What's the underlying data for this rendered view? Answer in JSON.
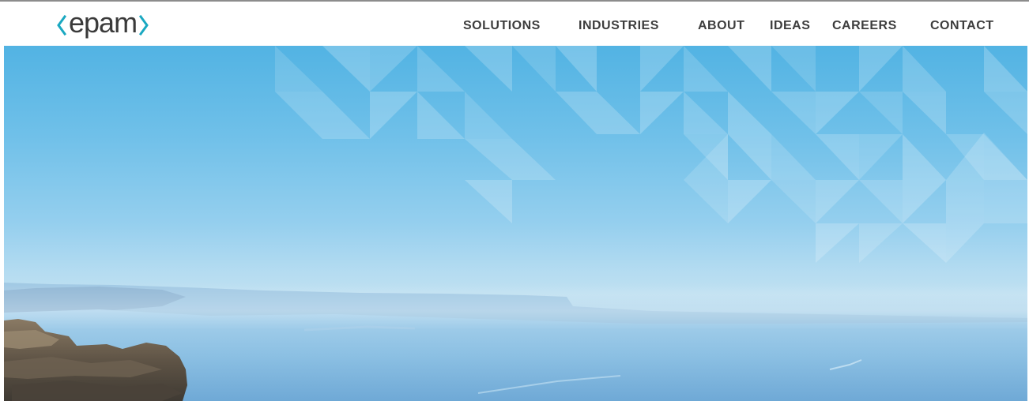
{
  "brand": {
    "logo_text": "epam",
    "accent_color": "#1aa8c1"
  },
  "nav": {
    "items": [
      {
        "id": "solutions",
        "label": "SOLUTIONS"
      },
      {
        "id": "industries",
        "label": "INDUSTRIES"
      },
      {
        "id": "about",
        "label": "ABOUT"
      },
      {
        "id": "ideas",
        "label": "IDEAS"
      },
      {
        "id": "careers",
        "label": "CAREERS"
      },
      {
        "id": "contact",
        "label": "CONTACT"
      }
    ]
  },
  "hero": {
    "sky_color": "#52b3e3",
    "haze_color": "#bfe0f1",
    "ground_color": "#78b1da",
    "pattern_color": "#ffffff"
  }
}
